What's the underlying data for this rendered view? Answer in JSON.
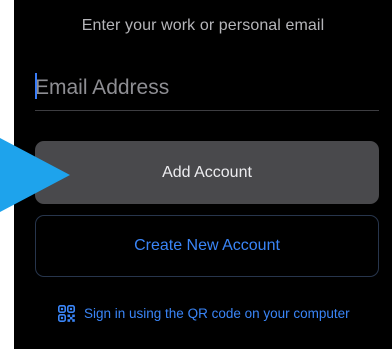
{
  "subtitle": "Enter your work or personal email",
  "email_field": {
    "placeholder": "Email Address",
    "value": ""
  },
  "buttons": {
    "add_account": "Add Account",
    "create_account": "Create New Account"
  },
  "qr_signin": {
    "label": "Sign in using the QR code on your computer",
    "icon": "qr-code-icon"
  },
  "colors": {
    "background": "#000000",
    "accent": "#3a85f7",
    "add_button_bg": "#49494c",
    "pointer_arrow": "#1ea3ec"
  }
}
